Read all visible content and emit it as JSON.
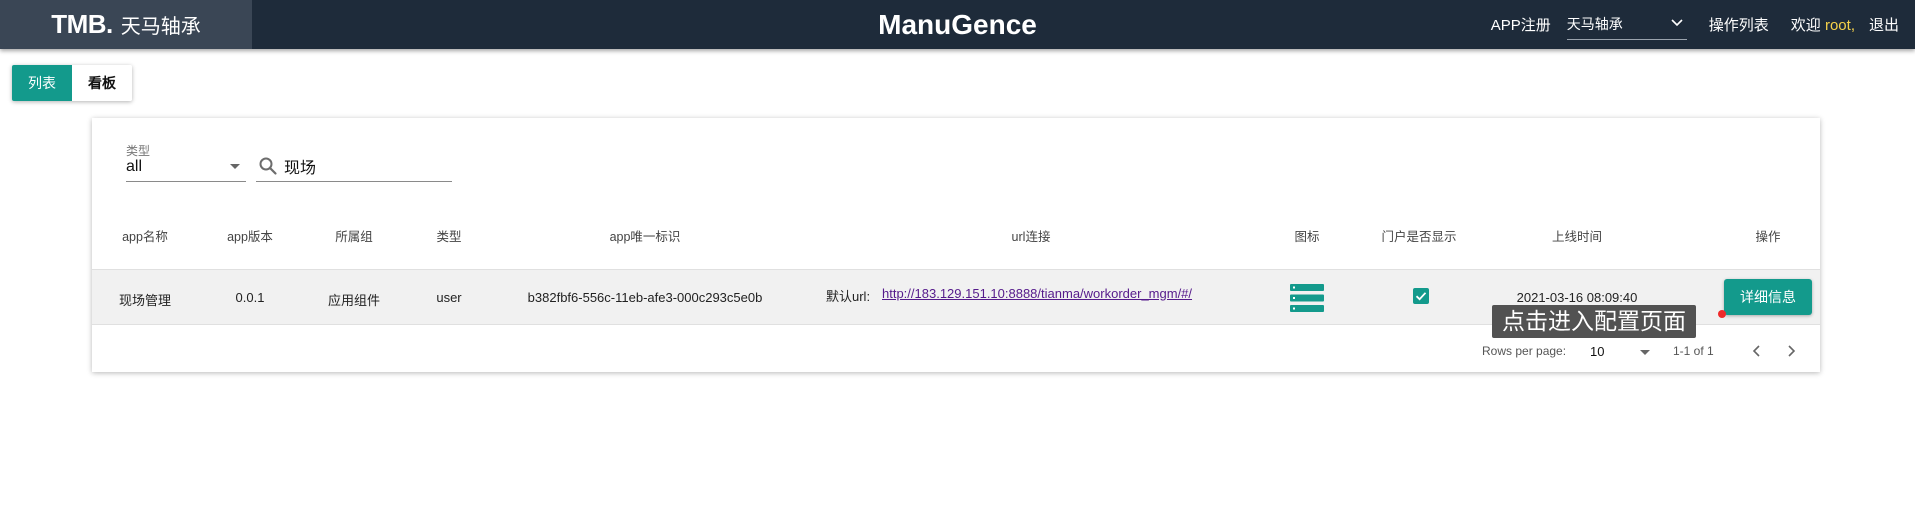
{
  "header": {
    "logo_mark": "TMB.",
    "logo_text": "天马轴承",
    "brand": "ManuGence",
    "app_register": "APP注册",
    "company_selected": "天马轴承",
    "operation_list": "操作列表",
    "welcome_prefix": "欢迎",
    "username": "root,",
    "logout": "退出"
  },
  "view_toggle": {
    "list_label": "列表",
    "board_label": "看板",
    "active": "list"
  },
  "filters": {
    "type_label": "类型",
    "type_value": "all",
    "search_value": "现场"
  },
  "table": {
    "columns": [
      "app名称",
      "app版本",
      "所属组",
      "类型",
      "app唯一标识",
      "url连接",
      "图标",
      "门户是否显示",
      "上线时间",
      "操作"
    ],
    "rows": [
      {
        "name": "现场管理",
        "version": "0.0.1",
        "group": "应用组件",
        "type": "user",
        "uid": "b382fbf6-556c-11eb-afe3-000c293c5e0b",
        "url_label": "默认url:",
        "url": "http://183.129.151.10:8888/tianma/workorder_mgm/#/",
        "icon": "list-icon",
        "portal_visible": true,
        "online_time": "2021-03-16 08:09:40",
        "action_label": "详细信息"
      }
    ]
  },
  "tooltip": "点击进入配置页面",
  "pagination": {
    "rows_per_page_label": "Rows per page:",
    "rows_per_page": "10",
    "range": "1-1 of 1"
  },
  "colors": {
    "header_bg": "#1e2b3a",
    "accent": "#139a8c",
    "username": "#f6d24a",
    "tooltip_bg": "#525252"
  }
}
